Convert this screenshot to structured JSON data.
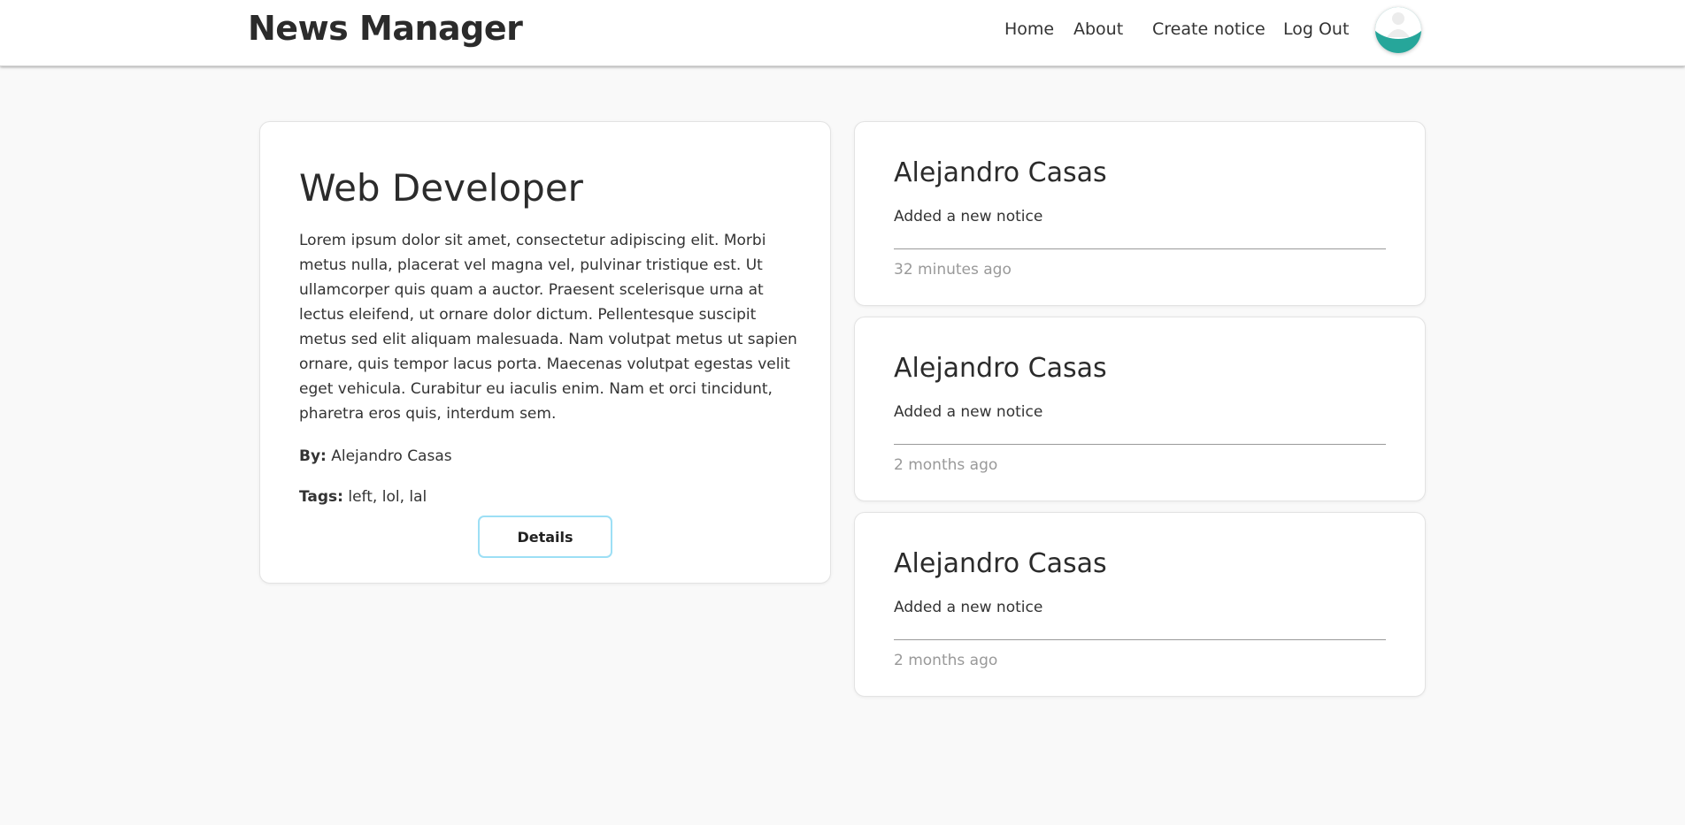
{
  "header": {
    "brand": "News Manager",
    "nav": [
      "Home",
      "About",
      "Create notice",
      "Log Out"
    ],
    "avatar_icon": "user-avatar-icon",
    "avatar_color": "#26a69a"
  },
  "main": {
    "title": "Web Developer",
    "body": "Lorem ipsum dolor sit amet, consectetur adipiscing elit. Morbi metus nulla, placerat vel magna vel, pulvinar tristique est. Ut ullamcorper quis quam a auctor. Praesent scelerisque urna at lectus eleifend, ut ornare dolor dictum. Pellentesque suscipit metus sed elit aliquam malesuada. Nam volutpat metus ut sapien ornare, quis tempor lacus porta. Maecenas volutpat egestas velit eget vehicula. Curabitur eu iaculis enim. Nam et orci tincidunt, pharetra eros quis, interdum sem.",
    "by_label": "By:",
    "by_value": "Alejandro Casas",
    "tags_label": "Tags:",
    "tags_value": "left, lol, lal",
    "details_button": "Details"
  },
  "activity": [
    {
      "name": "Alejandro Casas",
      "action": "Added a new notice",
      "time": "32 minutes ago"
    },
    {
      "name": "Alejandro Casas",
      "action": "Added a new notice",
      "time": "2 months ago"
    },
    {
      "name": "Alejandro Casas",
      "action": "Added a new notice",
      "time": "2 months ago"
    }
  ],
  "colors": {
    "page_background": "#f9f9f9",
    "button_border": "#9ddff5",
    "muted_text": "#999999"
  }
}
